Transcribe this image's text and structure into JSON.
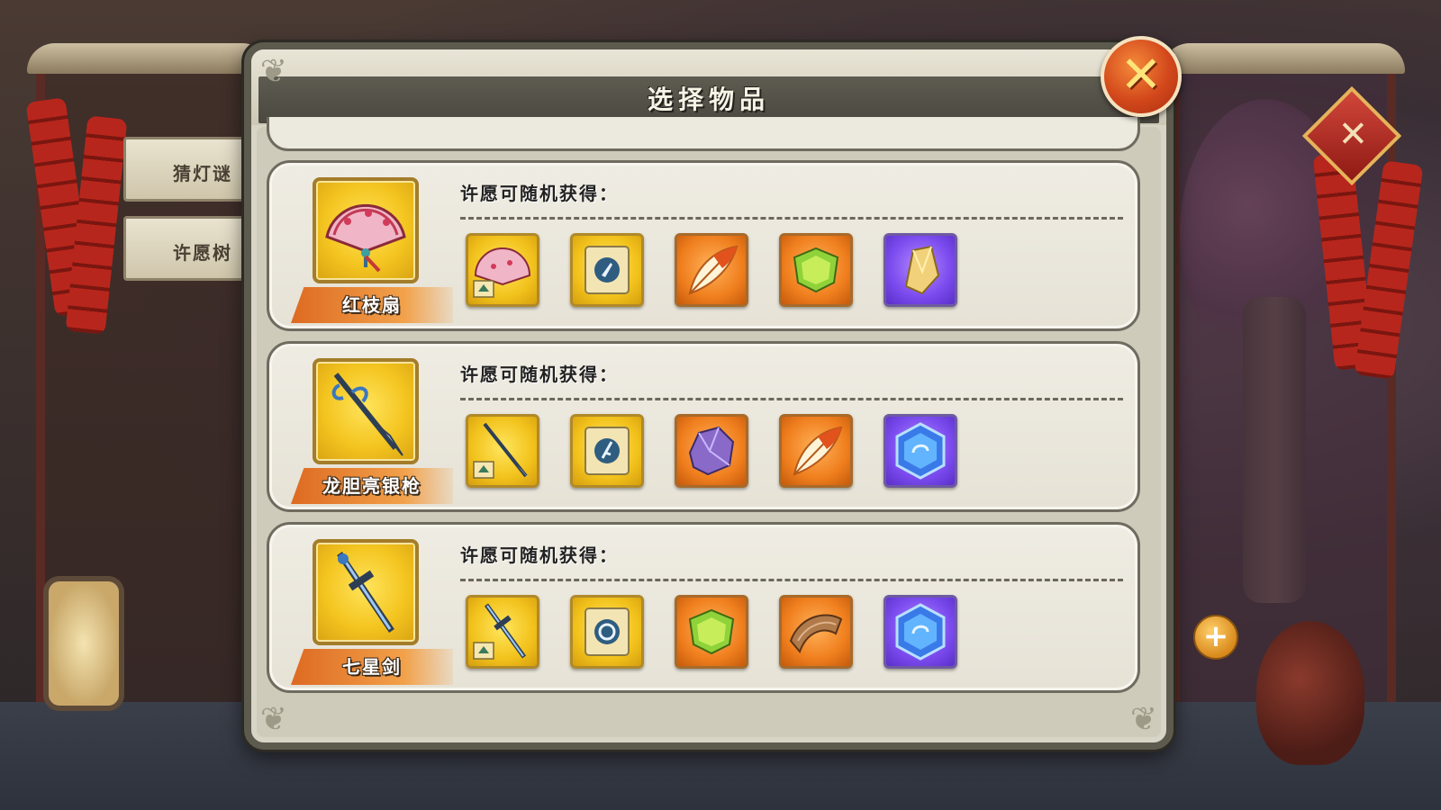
{
  "background": {
    "side_buttons": [
      "猜灯谜",
      "许愿树"
    ]
  },
  "dialog": {
    "title": "选择物品",
    "close_icon": "close-x-icon"
  },
  "colors": {
    "accent_orange": "#e8832f",
    "card_bg": "#ece9df",
    "title_band": "#54524a",
    "gold_slot": "#f4c520",
    "orange_slot": "#f07f1e",
    "purple_slot": "#7b4bee"
  },
  "items": [
    {
      "name": "红枝扇",
      "icon": "fan-icon",
      "wish_label": "许愿可随机获得：",
      "rewards": [
        {
          "icon": "fan-fragment-icon",
          "rarity": "gold"
        },
        {
          "icon": "scroll-icon",
          "rarity": "gold"
        },
        {
          "icon": "feather-icon",
          "rarity": "orange"
        },
        {
          "icon": "green-jade-icon",
          "rarity": "orange"
        },
        {
          "icon": "gold-crystal-icon",
          "rarity": "purple"
        }
      ]
    },
    {
      "name": "龙胆亮银枪",
      "icon": "spear-icon",
      "wish_label": "许愿可随机获得：",
      "rewards": [
        {
          "icon": "spear-fragment-icon",
          "rarity": "gold"
        },
        {
          "icon": "scroll-icon",
          "rarity": "gold"
        },
        {
          "icon": "purple-ore-icon",
          "rarity": "orange"
        },
        {
          "icon": "feather-icon",
          "rarity": "orange"
        },
        {
          "icon": "blue-hexagon-gem-icon",
          "rarity": "purple"
        }
      ]
    },
    {
      "name": "七星剑",
      "icon": "sword-icon",
      "wish_label": "许愿可随机获得：",
      "rewards": [
        {
          "icon": "sword-fragment-icon",
          "rarity": "gold"
        },
        {
          "icon": "scroll-icon",
          "rarity": "gold"
        },
        {
          "icon": "green-jade-icon",
          "rarity": "orange"
        },
        {
          "icon": "wood-plank-icon",
          "rarity": "orange"
        },
        {
          "icon": "blue-hexagon-gem-icon",
          "rarity": "purple"
        }
      ]
    }
  ]
}
